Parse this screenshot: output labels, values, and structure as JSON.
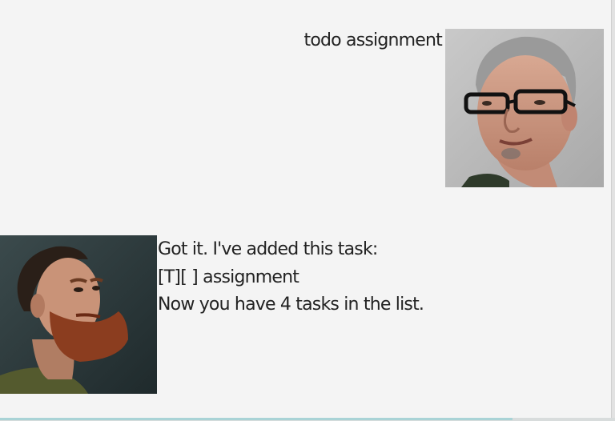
{
  "dialog": {
    "user_message": {
      "text": "todo assignment",
      "avatar": "user-avatar-photo"
    },
    "bot_message": {
      "lines": [
        "Got it. I've added this task:",
        "[T][ ] assignment",
        "Now you have 4 tasks in the list."
      ],
      "avatar": "bot-avatar-photo"
    }
  },
  "colors": {
    "background": "#f4f4f4",
    "text": "#222222",
    "scroll_highlight": "#a9d3d6"
  }
}
